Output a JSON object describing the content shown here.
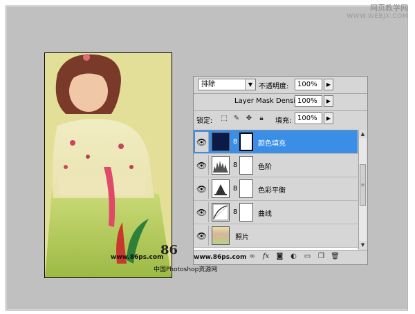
{
  "watermark": {
    "line1": "网页教学网",
    "line2": "WWW.WEBJX.COM"
  },
  "photo": {
    "site": "www.86ps.com",
    "logo": "86",
    "cn_site": "中国Photoshop资源网"
  },
  "panel": {
    "blend_mode": "排除",
    "opacity_label": "不透明度:",
    "opacity_value": "100%",
    "mask_density_label": "Layer Mask Density",
    "mask_density_value": "100%",
    "lock_label": "锁定:",
    "fill_label": "填充:",
    "fill_value": "100%",
    "layers": [
      {
        "name": "颜色填充",
        "selected": true,
        "thumb_icon": "solid-color-fill-icon"
      },
      {
        "name": "色阶",
        "selected": false,
        "thumb_icon": "levels-histogram-icon"
      },
      {
        "name": "色彩平衡",
        "selected": false,
        "thumb_icon": "color-balance-icon"
      },
      {
        "name": "曲线",
        "selected": false,
        "thumb_icon": "curves-icon"
      },
      {
        "name": "照片",
        "selected": false,
        "thumb_icon": "photo-thumbnail"
      }
    ],
    "bottom_site": "www.86ps.com",
    "bottom_icons": [
      "link-icon",
      "fx-icon",
      "mask-icon",
      "adjustment-icon",
      "folder-icon",
      "new-layer-icon",
      "trash-icon"
    ]
  },
  "colors": {
    "selected": "#3a8ee6",
    "fill_layer": "#0c1a48",
    "panel_bg": "#d6d6d6",
    "canvas_bg": "#c0c0c0"
  }
}
